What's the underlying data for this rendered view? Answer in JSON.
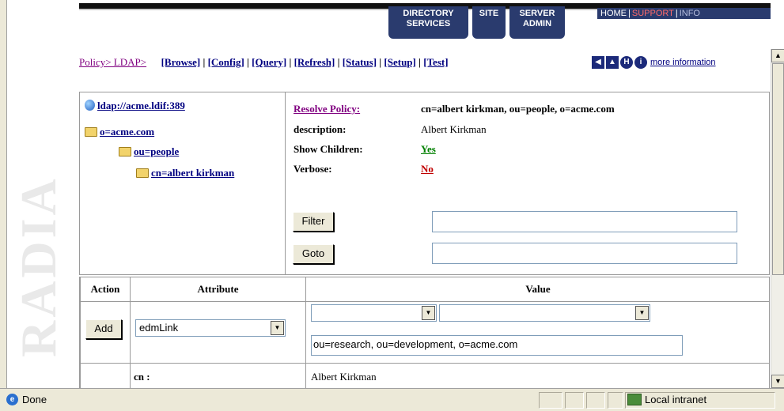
{
  "header": {
    "tabs": [
      {
        "line1": "DIRECTORY",
        "line2": "SERVICES"
      },
      {
        "line1": "SITE",
        "line2": ""
      },
      {
        "line1": "SERVER",
        "line2": "ADMIN"
      }
    ],
    "links": {
      "home": "HOME",
      "support": "SUPPORT",
      "info": "INFO"
    }
  },
  "watermark": "RADIA",
  "nav": {
    "breadcrumb": "Policy> LDAP>",
    "actions": [
      "[Browse]",
      "[Config]",
      "[Query]",
      "[Refresh]",
      "[Status]",
      "[Setup]",
      "[Test]"
    ],
    "more_info": "more information"
  },
  "tree": {
    "root": "ldap://acme.ldif:389",
    "level1": "o=acme.com",
    "level2": "ou=people",
    "level3": "cn=albert kirkman"
  },
  "details": {
    "resolve_label": "Resolve Policy:",
    "resolve_value": "cn=albert kirkman, ou=people, o=acme.com",
    "description_label": "description:",
    "description_value": "Albert Kirkman",
    "show_children_label": "Show Children:",
    "show_children_value": "Yes",
    "verbose_label": "Verbose:",
    "verbose_value": "No",
    "filter_button": "Filter",
    "filter_value": "",
    "goto_button": "Goto",
    "goto_value": ""
  },
  "table": {
    "headers": {
      "action": "Action",
      "attribute": "Attribute",
      "value": "Value"
    },
    "add_row": {
      "add_button": "Add",
      "attribute_select": "edmLink",
      "value_select_1": "",
      "value_select_2": "",
      "value_input": "ou=research, ou=development, o=acme.com"
    },
    "rows": [
      {
        "attribute": "cn :",
        "value": "Albert Kirkman"
      }
    ]
  },
  "statusbar": {
    "status": "Done",
    "zone": "Local intranet"
  },
  "colors": {
    "navy": "#2a3b6e",
    "link": "#000080",
    "visited": "#800080",
    "yes": "#008000",
    "no": "#c00000"
  }
}
